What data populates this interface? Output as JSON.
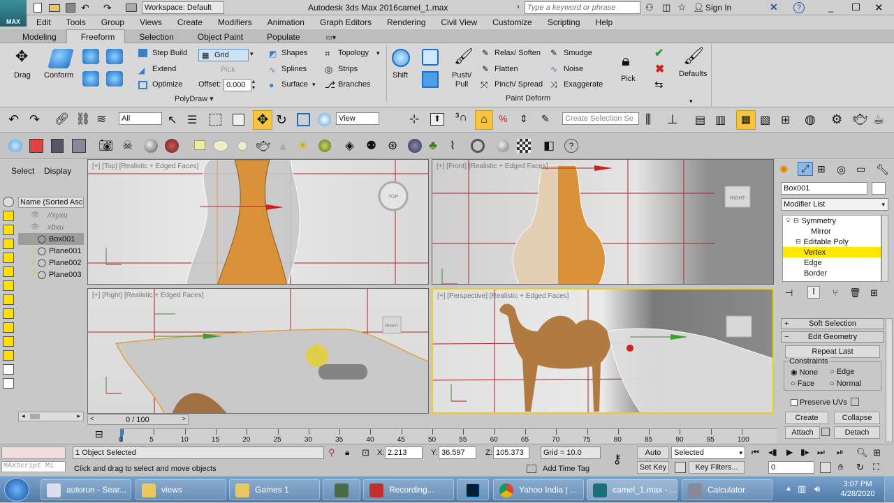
{
  "titlebar": {
    "app_logo": "MAX",
    "workspace": "Workspace: Default",
    "app_title": "Autodesk 3ds Max 2016",
    "file_title": "camel_1.max",
    "search_placeholder": "Type a keyword or phrase",
    "sign_in": "Sign In"
  },
  "menu": [
    "Edit",
    "Tools",
    "Group",
    "Views",
    "Create",
    "Modifiers",
    "Animation",
    "Graph Editors",
    "Rendering",
    "Civil View",
    "Customize",
    "Scripting",
    "Help"
  ],
  "ribbon_tabs": [
    "Modeling",
    "Freeform",
    "Selection",
    "Object Paint",
    "Populate"
  ],
  "ribbon": {
    "drag": "Drag",
    "conform": "Conform",
    "step_build": "Step Build",
    "extend": "Extend",
    "optimize": "Optimize",
    "grid": "Grid",
    "pick": "Pick",
    "offset_label": "Offset:",
    "offset_value": "0.000",
    "shapes": "Shapes",
    "splines": "Splines",
    "surface": "Surface",
    "topology": "Topology",
    "strips": "Strips",
    "branches": "Branches",
    "polydraw": "PolyDraw",
    "shift": "Shift",
    "push_pull": "Push/\nPull",
    "relax_soften": "Relax/ Soften",
    "flatten": "Flatten",
    "pinch_spread": "Pinch/ Spread",
    "smudge": "Smudge",
    "noise": "Noise",
    "exaggerate": "Exaggerate",
    "pick2": "Pick",
    "defaults": "Defaults",
    "paint_deform": "Paint Deform"
  },
  "toolbar": {
    "filter": "All",
    "ref_coord": "View",
    "selection_set_placeholder": "Create Selection Se"
  },
  "scene_explorer": {
    "select_tab": "Select",
    "display_tab": "Display",
    "column": "Name (Sorted Ascer",
    "items": [
      "//xyxu",
      "xbxu",
      "Box001",
      "Plane001",
      "Plane002",
      "Plane003"
    ]
  },
  "viewports": {
    "top_label": "[+] [Top] [Realistic + Edged Faces]",
    "front_label": "[+] [Front] [Realistic + Edged Faces]",
    "right_label": "[+] [Right] [Realistic + Edged Faces]",
    "persp_label": "[+] [Perspective] [Realistic + Edged Faces]",
    "cube_top": "TOP",
    "cube_right": "RIGHT",
    "cube_right2": "RIGHT",
    "cube_front": "RIGHT"
  },
  "command_panel": {
    "object_name": "Box001",
    "modifier_list": "Modifier List",
    "stack": [
      "Symmetry",
      "Mirror",
      "Editable Poly",
      "Vertex",
      "Edge",
      "Border"
    ],
    "soft_selection": "Soft Selection",
    "edit_geometry": "Edit Geometry",
    "repeat_last": "Repeat Last",
    "constraints": "Constraints",
    "none": "None",
    "edge": "Edge",
    "face": "Face",
    "normal": "Normal",
    "preserve_uvs": "Preserve UVs",
    "create": "Create",
    "collapse": "Collapse",
    "attach": "Attach",
    "detach": "Detach"
  },
  "timeline": {
    "frame": "0 / 100",
    "ticks": [
      "0",
      "5",
      "10",
      "15",
      "20",
      "25",
      "30",
      "35",
      "40",
      "45",
      "50",
      "55",
      "60",
      "65",
      "70",
      "75",
      "80",
      "85",
      "90",
      "95",
      "100"
    ]
  },
  "status": {
    "maxscript": "MAXScript Mi",
    "selected": "1 Object Selected",
    "prompt": "Click and drag to select and move objects",
    "x_label": "X:",
    "x": "2.213",
    "y_label": "Y:",
    "y": "36.597",
    "z_label": "Z:",
    "z": "105.373",
    "grid": "Grid = 10.0",
    "add_time_tag": "Add Time Tag",
    "auto_key": "Auto Key",
    "set_key": "Set Key",
    "selected_dropdown": "Selected",
    "key_filters": "Key Filters...",
    "frame_field": "0"
  },
  "taskbar": {
    "items": [
      "autorun - Sear...",
      "views",
      "Games 1",
      "",
      "Recording...",
      "",
      "Yahoo India | ...",
      "camel_1.max - ...",
      "Calculator"
    ],
    "time": "3:07 PM",
    "date": "4/28/2020"
  },
  "colors": {
    "accent_blue": "#2f7fd0",
    "vertex_highlight": "#ffe800",
    "active_viewport_border": "#e8d020"
  }
}
